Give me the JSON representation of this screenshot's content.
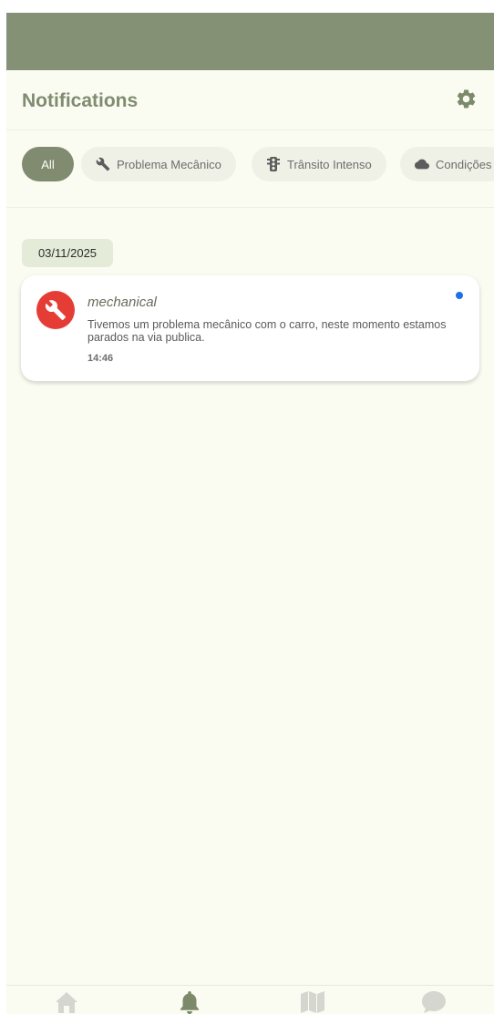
{
  "header": {
    "title": "Notifications",
    "settings_icon": "gear-icon"
  },
  "filters": [
    {
      "label": "All",
      "icon": "",
      "active": true
    },
    {
      "label": "Problema Mecânico",
      "icon": "wrench-icon",
      "active": false
    },
    {
      "label": "Trânsito Intenso",
      "icon": "traffic-light-icon",
      "active": false
    },
    {
      "label": "Condições",
      "icon": "cloud-icon",
      "active": false
    }
  ],
  "groups": [
    {
      "date": "03/11/2025",
      "notifications": [
        {
          "title": "mechanical",
          "body": "Tivemos um problema mecânico com o carro, neste momento estamos parados na via publica.",
          "time": "14:46",
          "icon": "wrench-icon",
          "unread": true
        }
      ]
    }
  ],
  "bottom_nav": [
    {
      "icon": "home-icon",
      "active": false
    },
    {
      "icon": "bell-icon",
      "active": true
    },
    {
      "icon": "map-icon",
      "active": false
    },
    {
      "icon": "chat-icon",
      "active": false
    }
  ],
  "colors": {
    "accent": "#808b70",
    "status_bar": "#849175",
    "background": "#fafcf2",
    "chip_background": "#eff1e6",
    "date_badge": "#e5ebd9",
    "notification_icon": "#e53d35",
    "unread_dot": "#1f6fe8",
    "nav_active": "#7d8a6a",
    "nav_inactive": "#d4d6cf"
  }
}
